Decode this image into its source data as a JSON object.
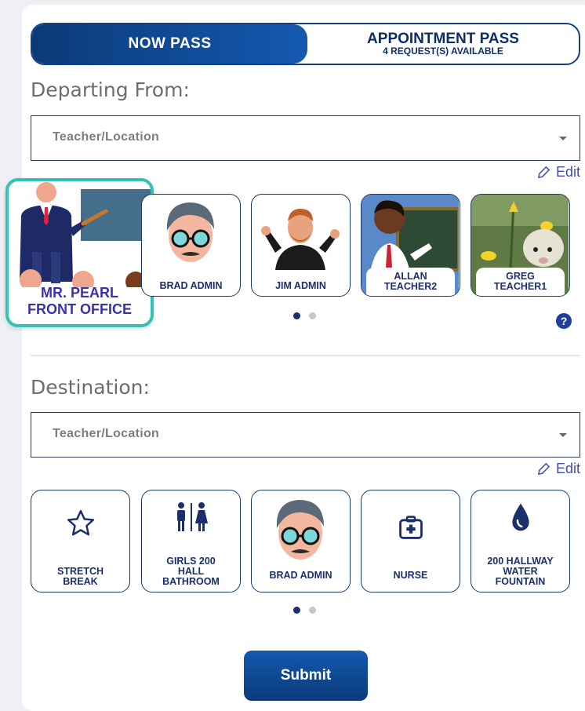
{
  "pass_type": {
    "now_label": "NOW PASS",
    "appointment_label": "APPOINTMENT PASS",
    "appointment_sub": "4 REQUEST(S) AVAILABLE"
  },
  "departing": {
    "label": "Departing From:",
    "placeholder": "Teacher/Location",
    "edit_label": "Edit",
    "featured": {
      "line1": "MR. PEARL",
      "line2": "FRONT OFFICE"
    },
    "tiles": [
      {
        "name": "BRAD ADMIN",
        "icon": "avatar-glasses-man"
      },
      {
        "name": "JIM ADMIN",
        "icon": "avatar-cartoon-man"
      },
      {
        "name_l1": "ALLAN",
        "name_l2": "TEACHER2",
        "icon": "avatar-teacher-boy"
      },
      {
        "name_l1": "GREG",
        "name_l2": "TEACHER1",
        "icon": "photo-lamb-flowers"
      }
    ],
    "help": "?"
  },
  "destination": {
    "label": "Destination:",
    "placeholder": "Teacher/Location",
    "edit_label": "Edit",
    "tiles": [
      {
        "l1": "STRETCH",
        "l2": "BREAK",
        "icon": "star-icon"
      },
      {
        "l1": "GIRLS 200",
        "l2": "HALL",
        "l3": "BATHROOM",
        "icon": "restroom-icon"
      },
      {
        "l1": "BRAD ADMIN",
        "icon": "avatar-glasses-man"
      },
      {
        "l1": "NURSE",
        "icon": "first-aid-icon"
      },
      {
        "l1": "200 HALLWAY",
        "l2": "WATER",
        "l3": "FOUNTAIN",
        "icon": "water-drop-icon"
      }
    ]
  },
  "submit_label": "Submit",
  "colors": {
    "primary": "#0b3a78",
    "accent": "#34c3b2",
    "text_dark": "#1c2f6b"
  }
}
